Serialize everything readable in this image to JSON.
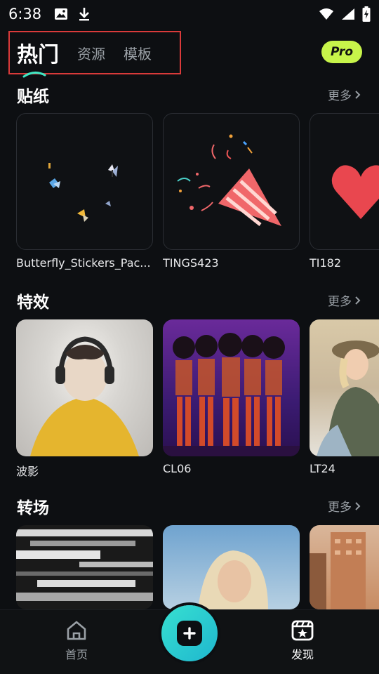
{
  "status": {
    "time": "6:38"
  },
  "tabs": {
    "active": "热门",
    "items": [
      "资源",
      "模板"
    ]
  },
  "pro_label": "Pro",
  "sections": [
    {
      "title": "贴纸",
      "more": "更多",
      "cards": [
        {
          "label": "Butterfly_Stickers_Pac..."
        },
        {
          "label": "TINGS423"
        },
        {
          "label": "TI182"
        }
      ]
    },
    {
      "title": "特效",
      "more": "更多",
      "cards": [
        {
          "label": "波影"
        },
        {
          "label": "CL06"
        },
        {
          "label": "LT24"
        }
      ]
    },
    {
      "title": "转场",
      "more": "更多",
      "cards": [
        {
          "label": ""
        },
        {
          "label": ""
        },
        {
          "label": ""
        }
      ]
    }
  ],
  "nav": {
    "home": "首页",
    "discover": "发现"
  },
  "colors": {
    "accent_pro": "#c7f44a",
    "fab": "#2ccfd0",
    "highlight_box": "#d93a3a"
  }
}
